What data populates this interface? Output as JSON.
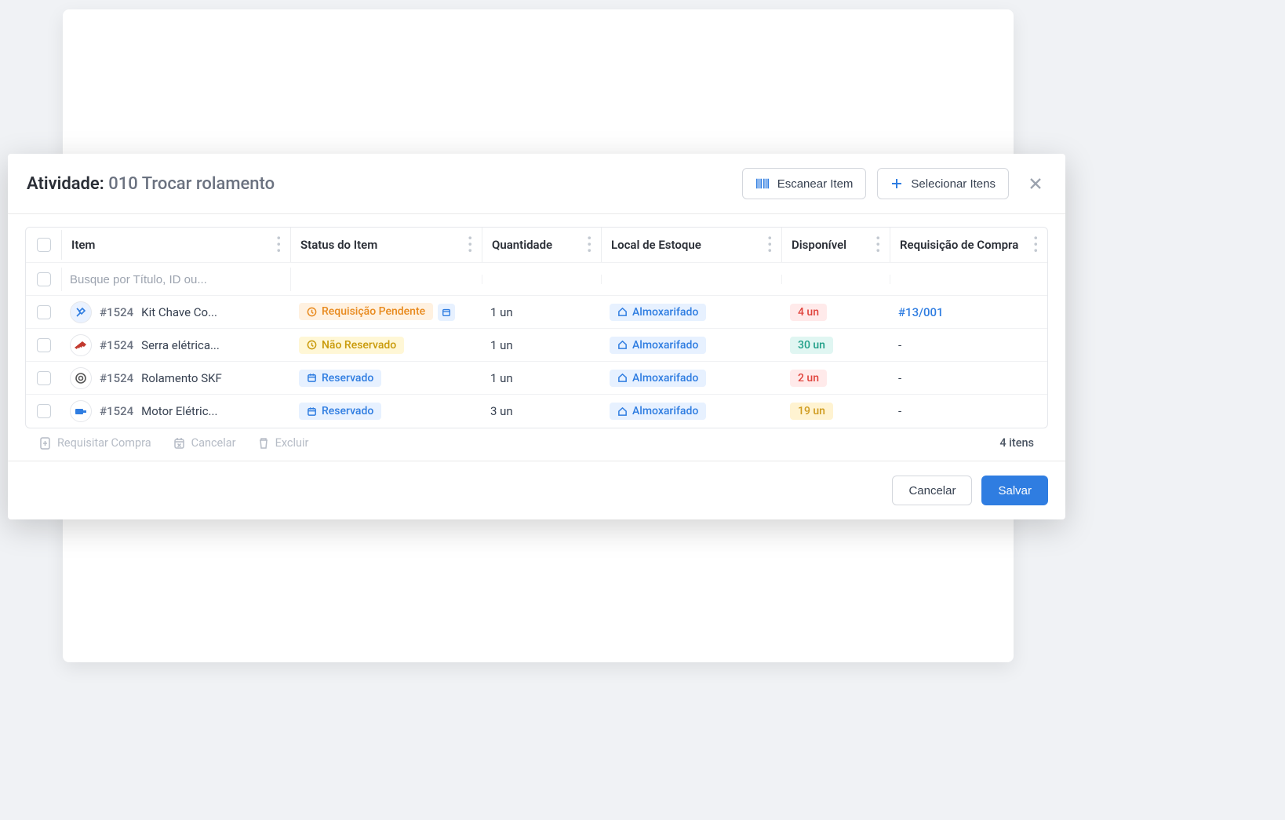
{
  "header": {
    "title_prefix": "Atividade: ",
    "title_sub": "010 Trocar rolamento",
    "scan_label": "Escanear Item",
    "select_label": "Selecionar Itens"
  },
  "columns": {
    "item": "Item",
    "status": "Status do Item",
    "qty": "Quantidade",
    "location": "Local de Estoque",
    "available": "Disponível",
    "req": "Requisição de Compra"
  },
  "search": {
    "placeholder": "Busque por Título, ID ou..."
  },
  "rows": [
    {
      "id": "#1524",
      "title": "Kit Chave Co...",
      "icon": "tools",
      "status_tag": "Requisição Pendente",
      "status_variant": "orange",
      "has_date": true,
      "qty": "1 un",
      "location": "Almoxarifado",
      "available": "4 un",
      "avail_variant": "red",
      "req": "#13/001"
    },
    {
      "id": "#1524",
      "title": "Serra elétrica...",
      "icon": "saw",
      "status_tag": "Não Reservado",
      "status_variant": "yellow",
      "has_date": false,
      "qty": "1 un",
      "location": "Almoxarifado",
      "available": "30 un",
      "avail_variant": "teal",
      "req": "-"
    },
    {
      "id": "#1524",
      "title": "Rolamento SKF",
      "icon": "bearing",
      "status_tag": "Reservado",
      "status_variant": "blue",
      "has_date": false,
      "qty": "1 un",
      "location": "Almoxarifado",
      "available": "2 un",
      "avail_variant": "red",
      "req": "-"
    },
    {
      "id": "#1524",
      "title": "Motor Elétric...",
      "icon": "motor",
      "status_tag": "Reservado",
      "status_variant": "blue",
      "has_date": false,
      "qty": "3 un",
      "location": "Almoxarifado",
      "available": "19 un",
      "avail_variant": "amber",
      "req": "-"
    }
  ],
  "footer_actions": {
    "request": "Requisitar Compra",
    "cancel": "Cancelar",
    "delete": "Excluir",
    "count": "4 itens"
  },
  "modal_footer": {
    "cancel": "Cancelar",
    "save": "Salvar"
  }
}
